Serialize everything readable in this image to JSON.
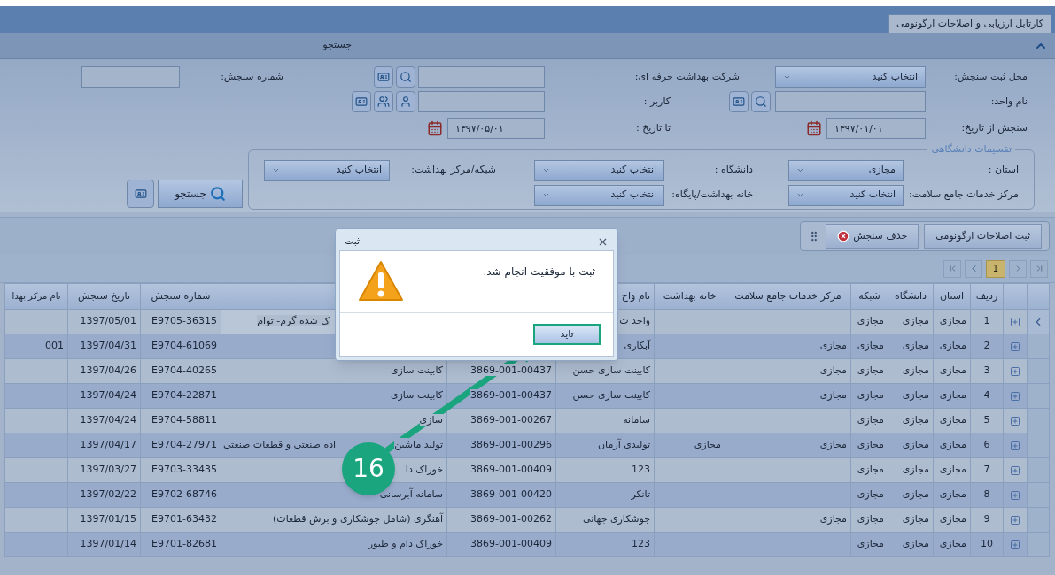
{
  "tabs": [
    {
      "label": "کارتابل ارزیابی و اصلاحات ارگونومی",
      "selected": true
    }
  ],
  "search_panel": {
    "title": "جستجو",
    "expanded": true
  },
  "form": {
    "place": {
      "label": "محل ثبت سنجش:",
      "value": "انتخاب کنید"
    },
    "company": {
      "label": "شرکت بهداشت حرفه ای:"
    },
    "assessment_no": {
      "label": "شماره سنجش:"
    },
    "unit_name": {
      "label": "نام واحد:"
    },
    "user": {
      "label": "کاربر :"
    },
    "date_from": {
      "label": "سنجش از تاریخ:",
      "value": "۱۳۹۷/۰۱/۰۱"
    },
    "date_to": {
      "label": "تا تاریخ :",
      "value": "۱۳۹۷/۰۵/۰۱"
    }
  },
  "divisions": {
    "legend": "تقسیمات دانشگاهی",
    "selects": [
      {
        "label": "استان :",
        "value": "مجازی"
      },
      {
        "label": "دانشگاه :",
        "value": "انتخاب کنید"
      },
      {
        "label": "شبکه/مرکز بهداشت:",
        "value": "انتخاب کنید"
      },
      {
        "label": "مرکز خدمات جامع سلامت:",
        "value": "انتخاب کنید"
      },
      {
        "label": "خانه بهداشت/پایگاه:",
        "value": "انتخاب کنید"
      }
    ]
  },
  "search_button": "جستجو",
  "toolbar": [
    {
      "label": "ثبت اصلاحات ارگونومی",
      "kind": "plain"
    },
    {
      "label": "حذف سنجش",
      "kind": "delete"
    }
  ],
  "pager": {
    "pages": [
      {
        "label": "1",
        "selected": true
      }
    ]
  },
  "table": {
    "columns": [
      {
        "label": "ردیف"
      },
      {
        "label": "استان"
      },
      {
        "label": "دانشگاه"
      },
      {
        "label": "شبکه"
      },
      {
        "label": "مرکز خدمات جامع سلامت"
      },
      {
        "label": "خانه بهداشت"
      },
      {
        "label": "نام واح"
      },
      {},
      {},
      {
        "label": "شماره سنجش"
      },
      {
        "label": "تاریخ سنجش"
      },
      {
        "label": "نام مرکز بهدا"
      }
    ],
    "rows": [
      {
        "current": true,
        "cells": [
          "1",
          "مجازی",
          "مجازی",
          "مجازی",
          null,
          null,
          "واحد ت",
          null,
          "ک شده گرم- توام",
          "E9705-36315",
          "1397/05/01",
          null
        ]
      },
      {
        "current": false,
        "cells": [
          "2",
          "مجازی",
          "مجازی",
          "مجازی",
          "مجازی",
          null,
          "آبکاری",
          null,
          null,
          "E9704-61069",
          "1397/04/31",
          "001"
        ]
      },
      {
        "current": false,
        "cells": [
          "3",
          "مجازی",
          "مجازی",
          "مجازی",
          "مجازی",
          null,
          "کابینت سازی حسن",
          "3869-001-00437",
          "کابینت سازی",
          "E9704-40265",
          "1397/04/26",
          null
        ]
      },
      {
        "current": false,
        "cells": [
          "4",
          "مجازی",
          "مجازی",
          "مجازی",
          "مجازی",
          null,
          "کابینت سازی حسن",
          "3869-001-00437",
          "کابینت سازی",
          "E9704-22871",
          "1397/04/24",
          null
        ]
      },
      {
        "current": false,
        "cells": [
          "5",
          "مجازی",
          "مجازی",
          "مجازی",
          null,
          null,
          "سامانه",
          "3869-001-00267",
          "سازی",
          "E9704-58811",
          "1397/04/24",
          null
        ]
      },
      {
        "current": false,
        "cells": [
          "6",
          "مجازی",
          "مجازی",
          "مجازی",
          "مجازی",
          "مجازی",
          "تولیدی آرمان",
          "3869-001-00296",
          [
            "تولید ماشین",
            "اده صنعتی و قطعات صنعتی"
          ],
          "E9704-27971",
          "1397/04/17",
          null
        ]
      },
      {
        "current": false,
        "cells": [
          "7",
          "مجازی",
          "مجازی",
          "مجازی",
          null,
          null,
          "123",
          "3869-001-00409",
          "خوراک دا",
          "E9703-33435",
          "1397/03/27",
          null
        ]
      },
      {
        "current": false,
        "cells": [
          "8",
          "مجازی",
          "مجازی",
          "مجازی",
          null,
          null,
          "تانکر",
          "3869-001-00420",
          "سامانه آبرسانی",
          "E9702-68746",
          "1397/02/22",
          null
        ]
      },
      {
        "current": false,
        "cells": [
          "9",
          "مجازی",
          "مجازی",
          "مجازی",
          "مجازی",
          null,
          "جوشکاری جهانی",
          "3869-001-00262",
          "آهنگری (شامل جوشکاری و برش قطعات)",
          "E9701-63432",
          "1397/01/15",
          null
        ]
      },
      {
        "current": false,
        "cells": [
          "10",
          "مجازی",
          "مجازی",
          "مجازی",
          null,
          null,
          "123",
          "3869-001-00409",
          "خوراک دام و طیور",
          "E9701-82681",
          "1397/01/14",
          null
        ]
      }
    ]
  },
  "dialog": {
    "title": "ثبت",
    "message": "ثبت با موفقیت انجام شد.",
    "button": "تاید"
  },
  "annotation": {
    "label": "16"
  }
}
